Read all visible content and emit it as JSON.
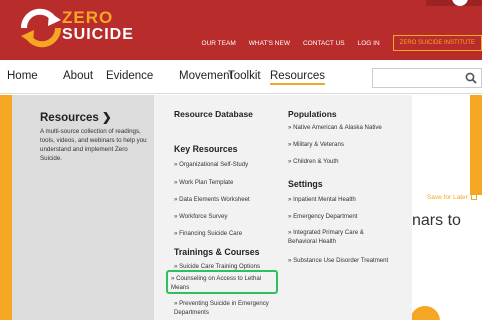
{
  "header": {
    "logo_top": "ZERO",
    "logo_bottom": "SUICIDE",
    "top_links": [
      "OUR TEAM",
      "WHAT'S NEW",
      "CONTACT US",
      "LOG IN"
    ],
    "institute_button": "ZERO SUICIDE INSTITUTE"
  },
  "nav": {
    "items": [
      "Home",
      "About",
      "Evidence",
      "Movement",
      "Toolkit",
      "Resources"
    ],
    "active": "Resources",
    "search_placeholder": ""
  },
  "mega_menu": {
    "title": "Resources ❯",
    "description": "A multi-source collection of readings, tools, videos, and webinars to help you understand and implement Zero Suicide.",
    "resource_database": "Resource Database",
    "key_resources": {
      "title": "Key Resources",
      "links": [
        "» Organizational Self-Study",
        "» Work Plan Template",
        "» Data Elements Worksheet",
        "» Workforce Survey",
        "» Financing Suicide Care"
      ]
    },
    "trainings": {
      "title": "Trainings & Courses",
      "links": [
        "» Suicide Care Training Options",
        "» Counseling on Access to Lethal Means",
        "» Preventing Suicide in Emergency Departments"
      ]
    },
    "populations": {
      "title": "Populations",
      "links": [
        "» Native American & Alaska Native",
        "» Military & Veterans",
        "» Children & Youth"
      ]
    },
    "settings": {
      "title": "Settings",
      "links": [
        "» Inpatient Mental Health",
        "» Emergency Department",
        "» Integrated Primary Care & Behavioral Health",
        "» Substance Use Disorder Treatment"
      ]
    }
  },
  "page": {
    "save_later": "Save for Later",
    "heading_fragment": "nars to"
  },
  "colors": {
    "header_red": "#b92c2c",
    "accent_orange": "#f5a623",
    "highlight_green": "#2fbf5f"
  }
}
